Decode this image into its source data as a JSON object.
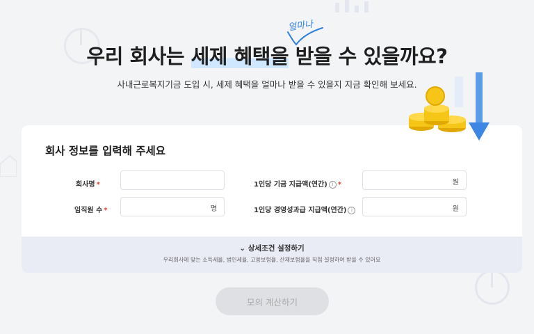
{
  "hero": {
    "title_pre": "우리 회사는 ",
    "title_mark": "세제 혜택을",
    "title_post": " 받을 수 있을까요?",
    "handwritten_note": "얼마나",
    "subtitle": "사내근로복지기금 도입 시, 세제 혜택을 얼마나 받을 수 있을지 지금 확인해 보세요."
  },
  "form": {
    "title": "회사 정보를 입력해 주세요",
    "company_name": {
      "label": "회사명",
      "required_mark": "*",
      "value": "",
      "unit": ""
    },
    "employee_count": {
      "label": "임직원 수",
      "required_mark": "*",
      "value": "",
      "unit": "명"
    },
    "fund_payment": {
      "label": "1인당 기금 지급액(연간)",
      "info_icon": "info-icon",
      "required_mark": "*",
      "value": "",
      "unit": "원"
    },
    "incentive_payment": {
      "label": "1인당 경영성과급 지급액(연간)",
      "info_icon": "info-icon",
      "value": "",
      "unit": "원"
    }
  },
  "details": {
    "toggle_label": "상세조건 설정하기",
    "toggle_icon": "chevron-down-icon",
    "description": "우리회사에 맞는 소득세율, 법인세율, 고용보험율, 산재보험율을 직접 설정하여 받을 수 있어요"
  },
  "actions": {
    "calculate_label": "모의 계산하기"
  },
  "colors": {
    "accent_blue": "#2d7fe0",
    "required_red": "#e2453c",
    "panel_bg": "#e9ebf5",
    "disabled_button": "#dfe0e4",
    "coin_yellow": "#f5c518"
  }
}
